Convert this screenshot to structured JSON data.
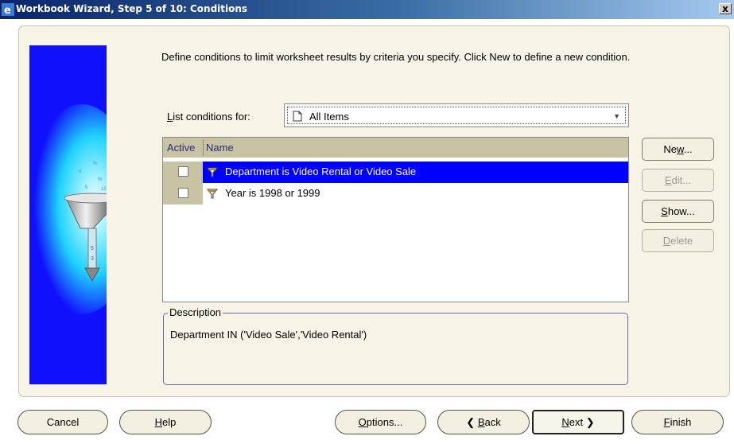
{
  "window": {
    "title": "Workbook Wizard, Step 5 of 10: Conditions",
    "close_label": "x"
  },
  "intro_text": "Define conditions to limit worksheet results by criteria you specify. Click New to define a new condition.",
  "list_for": {
    "label_prefix": "L",
    "label_rest": "ist conditions for:",
    "selected": "All Items"
  },
  "grid": {
    "headers": {
      "active": "Active",
      "name": "Name"
    },
    "rows": [
      {
        "name": "Department is Video Rental or Video Sale",
        "active": false,
        "selected": true
      },
      {
        "name": "Year is 1998 or 1999",
        "active": false,
        "selected": false
      }
    ]
  },
  "side_buttons": {
    "new": {
      "pre": "Ne",
      "mnemonic": "w",
      "post": "...",
      "enabled": true
    },
    "edit": {
      "pre": "",
      "mnemonic": "E",
      "post": "dit...",
      "enabled": false
    },
    "show": {
      "pre": "",
      "mnemonic": "S",
      "post": "how...",
      "enabled": true
    },
    "delete": {
      "pre": "",
      "mnemonic": "D",
      "post": "elete",
      "enabled": false
    }
  },
  "description": {
    "legend": "Description",
    "text": "Department IN ('Video Sale','Video Rental')"
  },
  "bottom_buttons": {
    "cancel": {
      "pre": "Cancel",
      "mnemonic": "",
      "post": ""
    },
    "help": {
      "pre": "",
      "mnemonic": "H",
      "post": "elp"
    },
    "options": {
      "pre": "",
      "mnemonic": "O",
      "post": "ptions..."
    },
    "back": {
      "arrow": "❮",
      "pre": "",
      "mnemonic": "B",
      "post": "ack"
    },
    "next": {
      "pre": "",
      "mnemonic": "N",
      "post": "ext",
      "arrow": "❯"
    },
    "finish": {
      "pre": "",
      "mnemonic": "F",
      "post": "inish"
    }
  },
  "colors": {
    "title_bar": "#0a246a",
    "selection": "#0000ff",
    "panel": "#f7f3e6",
    "grid_header": "#c7c3a3",
    "side_art": "#1010ff"
  },
  "icons": {
    "title": "app-e-icon",
    "combo": "document-icon",
    "condition": "funnel-icon",
    "art": "funnel-illustration"
  }
}
